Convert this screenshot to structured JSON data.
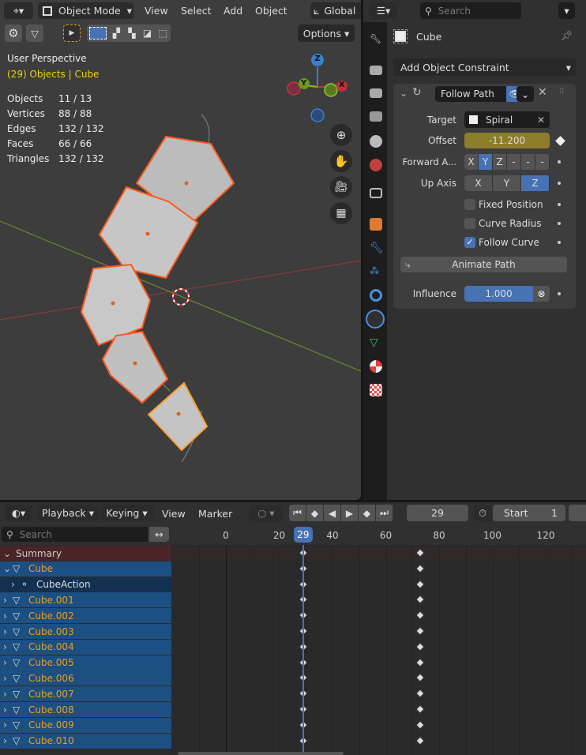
{
  "viewport": {
    "header": {
      "mode": "Object Mode",
      "menus": [
        "View",
        "Select",
        "Add",
        "Object"
      ],
      "orientation": "Global",
      "options": "Options"
    },
    "overlay": {
      "perspective": "User Perspective",
      "context": "(29) Objects | Cube"
    },
    "stats": [
      {
        "label": "Objects",
        "value": "11 / 13"
      },
      {
        "label": "Vertices",
        "value": "88 / 88"
      },
      {
        "label": "Edges",
        "value": "132 / 132"
      },
      {
        "label": "Faces",
        "value": "66 / 66"
      },
      {
        "label": "Triangles",
        "value": "132 / 132"
      }
    ],
    "gizmo": {
      "x": "X",
      "y": "Y",
      "z": "Z"
    }
  },
  "properties": {
    "search_placeholder": "Search",
    "object_name": "Cube",
    "add_constraint": "Add Object Constraint",
    "constraint": {
      "name": "Follow Path",
      "target_label": "Target",
      "target": "Spiral",
      "offset_label": "Offset",
      "offset": "-11.200",
      "forward_label": "Forward A...",
      "forward_options": [
        "X",
        "Y",
        "Z",
        "-",
        "-",
        "-"
      ],
      "forward_selected": "Y",
      "up_label": "Up Axis",
      "up_options": [
        "X",
        "Y",
        "Z"
      ],
      "up_selected": "Z",
      "fixed_position": {
        "label": "Fixed Position",
        "checked": false
      },
      "curve_radius": {
        "label": "Curve Radius",
        "checked": false
      },
      "follow_curve": {
        "label": "Follow Curve",
        "checked": true
      },
      "animate_path": "Animate Path",
      "influence_label": "Influence",
      "influence": "1.000"
    }
  },
  "timeline": {
    "menus": {
      "playback": "Playback",
      "keying": "Keying",
      "view": "View",
      "marker": "Marker"
    },
    "current_frame": "29",
    "start_label": "Start",
    "start": "1",
    "search_placeholder": "Search",
    "ruler": [
      "0",
      "20",
      "40",
      "60",
      "80",
      "100",
      "120"
    ],
    "channels": [
      {
        "name": "Summary",
        "type": "summary"
      },
      {
        "name": "Cube",
        "type": "object-open"
      },
      {
        "name": "CubeAction",
        "type": "action"
      },
      {
        "name": "Cube.001",
        "type": "object"
      },
      {
        "name": "Cube.002",
        "type": "object"
      },
      {
        "name": "Cube.003",
        "type": "object"
      },
      {
        "name": "Cube.004",
        "type": "object"
      },
      {
        "name": "Cube.005",
        "type": "object"
      },
      {
        "name": "Cube.006",
        "type": "object"
      },
      {
        "name": "Cube.007",
        "type": "object"
      },
      {
        "name": "Cube.008",
        "type": "object"
      },
      {
        "name": "Cube.009",
        "type": "object"
      },
      {
        "name": "Cube.010",
        "type": "object"
      }
    ],
    "keyframes": [
      29,
      73
    ]
  },
  "colors": {
    "accent": "#4772b3",
    "selected_orange": "#ff8c00",
    "offset_anim": "#8b7d29",
    "text_yellow": "#e8d600"
  }
}
